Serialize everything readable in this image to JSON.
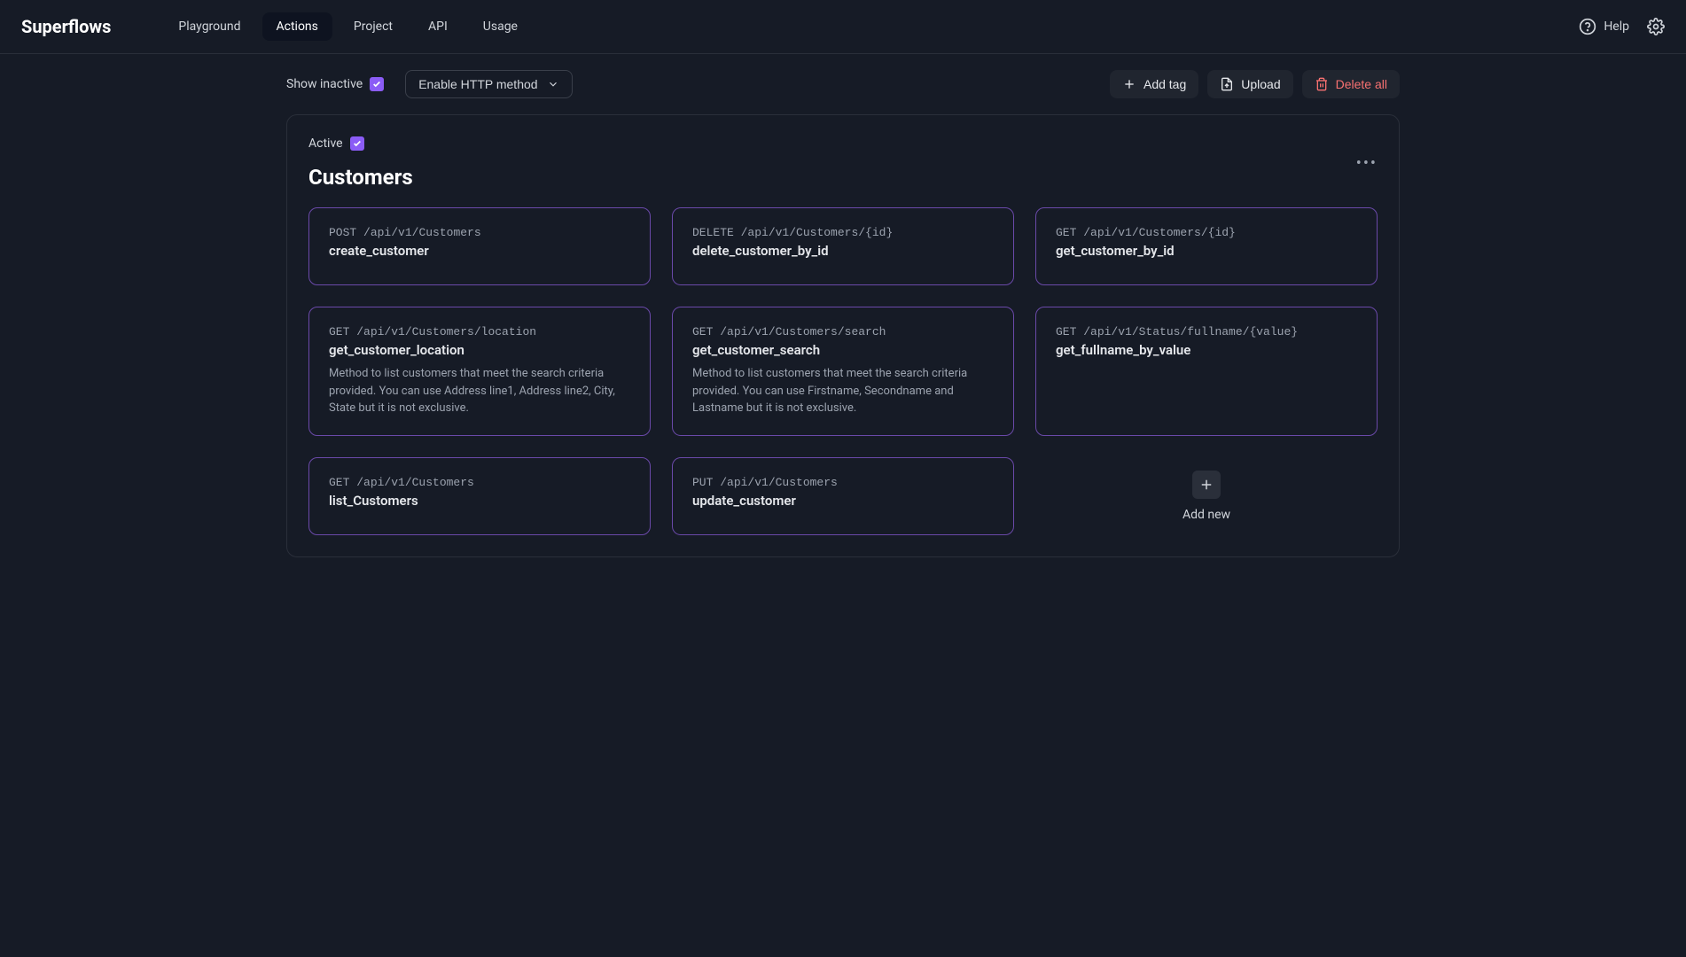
{
  "header": {
    "brand": "Superflows",
    "nav": [
      {
        "label": "Playground",
        "active": false
      },
      {
        "label": "Actions",
        "active": true
      },
      {
        "label": "Project",
        "active": false
      },
      {
        "label": "API",
        "active": false
      },
      {
        "label": "Usage",
        "active": false
      }
    ],
    "help_label": "Help"
  },
  "toolbar": {
    "show_inactive_label": "Show inactive",
    "show_inactive_checked": true,
    "http_method_label": "Enable HTTP method",
    "buttons": {
      "add_tag": "Add tag",
      "upload": "Upload",
      "delete_all": "Delete all"
    }
  },
  "section": {
    "active_label": "Active",
    "active_checked": true,
    "title": "Customers",
    "add_new_label": "Add new",
    "cards": [
      {
        "method": "POST",
        "path": "/api/v1/Customers",
        "name": "create_customer",
        "desc": ""
      },
      {
        "method": "DELETE",
        "path": "/api/v1/Customers/{id}",
        "name": "delete_customer_by_id",
        "desc": ""
      },
      {
        "method": "GET",
        "path": "/api/v1/Customers/{id}",
        "name": "get_customer_by_id",
        "desc": ""
      },
      {
        "method": "GET",
        "path": "/api/v1/Customers/location",
        "name": "get_customer_location",
        "desc": "Method to list customers that meet the search criteria provided. You can use Address line1, Address line2, City, State but it is not exclusive."
      },
      {
        "method": "GET",
        "path": "/api/v1/Customers/search",
        "name": "get_customer_search",
        "desc": "Method to list customers that meet the search criteria provided. You can use Firstname, Secondname and Lastname but it is not exclusive."
      },
      {
        "method": "GET",
        "path": "/api/v1/Status/fullname/{value}",
        "name": "get_fullname_by_value",
        "desc": ""
      },
      {
        "method": "GET",
        "path": "/api/v1/Customers",
        "name": "list_Customers",
        "desc": ""
      },
      {
        "method": "PUT",
        "path": "/api/v1/Customers",
        "name": "update_customer",
        "desc": ""
      }
    ]
  }
}
